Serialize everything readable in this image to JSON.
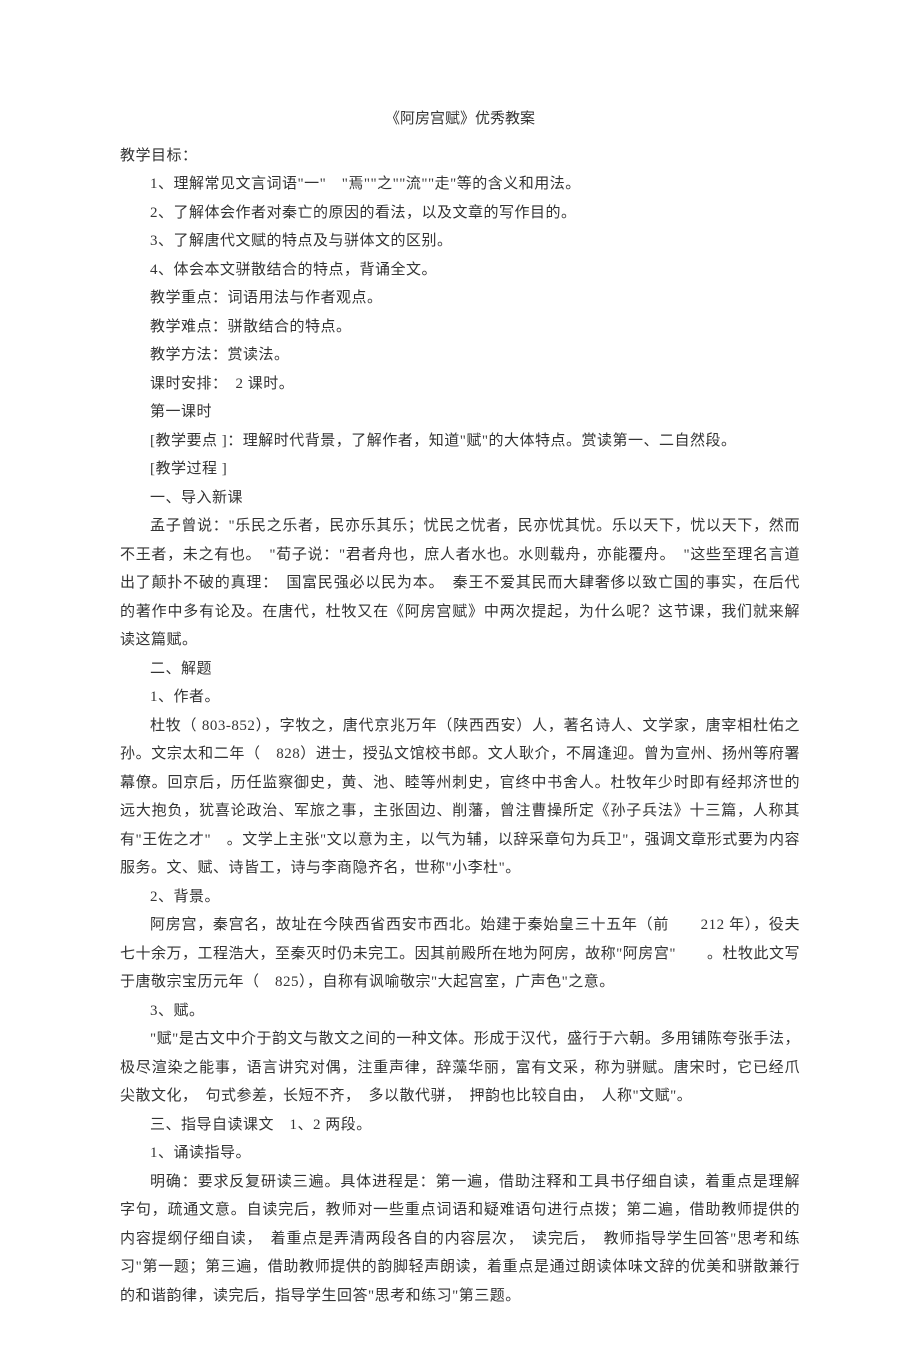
{
  "title": "《阿房宫赋》优秀教案",
  "heading_goals": "教学目标：",
  "goal_1": "1、理解常见文言词语\"一\"　\"焉\"\"之\"\"流\"\"走\"等的含义和用法。",
  "goal_2": "2、了解体会作者对秦亡的原因的看法，以及文章的写作目的。",
  "goal_3": "3、了解唐代文赋的特点及与骈体文的区别。",
  "goal_4": "4、体会本文骈散结合的特点，背诵全文。",
  "focus": "教学重点：词语用法与作者观点。",
  "difficulty": "教学难点：骈散结合的特点。",
  "method": "教学方法：赏读法。",
  "schedule": "课时安排：　2 课时。",
  "period": "第一课时",
  "points": "[教学要点 ]：理解时代背景，了解作者，知道\"赋\"的大体特点。赏读第一、二自然段。",
  "process": "[教学过程 ]",
  "sec1_title": "一、导入新课",
  "sec1_p1": "孟子曾说：\"乐民之乐者，民亦乐其乐；忧民之忧者，民亦忧其忧。乐以天下，忧以天下，然而不王者，未之有也。　\"荀子说：\"君者舟也，庶人者水也。水则载舟，亦能覆舟。　\"这些至理名言道出了颠扑不破的真理：　国富民强必以民为本。　秦王不爱其民而大肆奢侈以致亡国的事实，在后代的著作中多有论及。在唐代，杜牧又在《阿房宫赋》中两次提起，为什么呢？这节课，我们就来解读这篇赋。",
  "sec2_title": "二、解题",
  "sec2_1_label": "1、作者。",
  "sec2_1_p": "杜牧（ 803-852），字牧之，唐代京兆万年（陕西西安）人，著名诗人、文学家，唐宰相杜佑之孙。文宗太和二年（　828）进士，授弘文馆校书郎。文人耿介，不屑逢迎。曾为宣州、扬州等府署幕僚。回京后，历任监察御史，黄、池、睦等州刺史，官终中书舍人。杜牧年少时即有经邦济世的远大抱负，犹喜论政治、军旅之事，主张固边、削藩，曾注曹操所定《孙子兵法》十三篇，人称其有\"王佐之才\"　。文学上主张\"文以意为主，以气为辅，以辞采章句为兵卫\"，强调文章形式要为内容服务。文、赋、诗皆工，诗与李商隐齐名，世称\"小李杜\"。",
  "sec2_2_label": "2、背景。",
  "sec2_2_p": "阿房宫，秦宫名，故址在今陕西省西安市西北。始建于秦始皇三十五年（前　　212 年），役夫七十余万，工程浩大，至秦灭时仍未完工。因其前殿所在地为阿房，故称\"阿房宫\"　　。杜牧此文写于唐敬宗宝历元年（　825），自称有讽喻敬宗\"大起宫室，广声色\"之意。",
  "sec2_3_label": "3、赋。",
  "sec2_3_p": "\"赋\"是古文中介于韵文与散文之间的一种文体。形成于汉代，盛行于六朝。多用铺陈夸张手法，极尽渲染之能事，语言讲究对偶，注重声律，辞藻华丽，富有文采，称为骈赋。唐宋时，它已经爪尖散文化，　句式参差，长短不齐，　多以散代骈，　押韵也比较自由，　人称\"文赋\"。",
  "sec3_title": "三、指导自读课文　1、2 两段。",
  "sec3_1_label": "1、诵读指导。",
  "sec3_1_p": "明确：要求反复研读三遍。具体进程是：第一遍，借助注释和工具书仔细自读，着重点是理解字句，疏通文意。自读完后，教师对一些重点词语和疑难语句进行点拨；第二遍，借助教师提供的内容提纲仔细自读，　着重点是弄清两段各自的内容层次，　读完后，　教师指导学生回答\"思考和练习\"第一题；第三遍，借助教师提供的韵脚轻声朗读，着重点是通过朗读体味文辞的优美和骈散兼行的和谐韵律，读完后，指导学生回答\"思考和练习\"第三题。"
}
